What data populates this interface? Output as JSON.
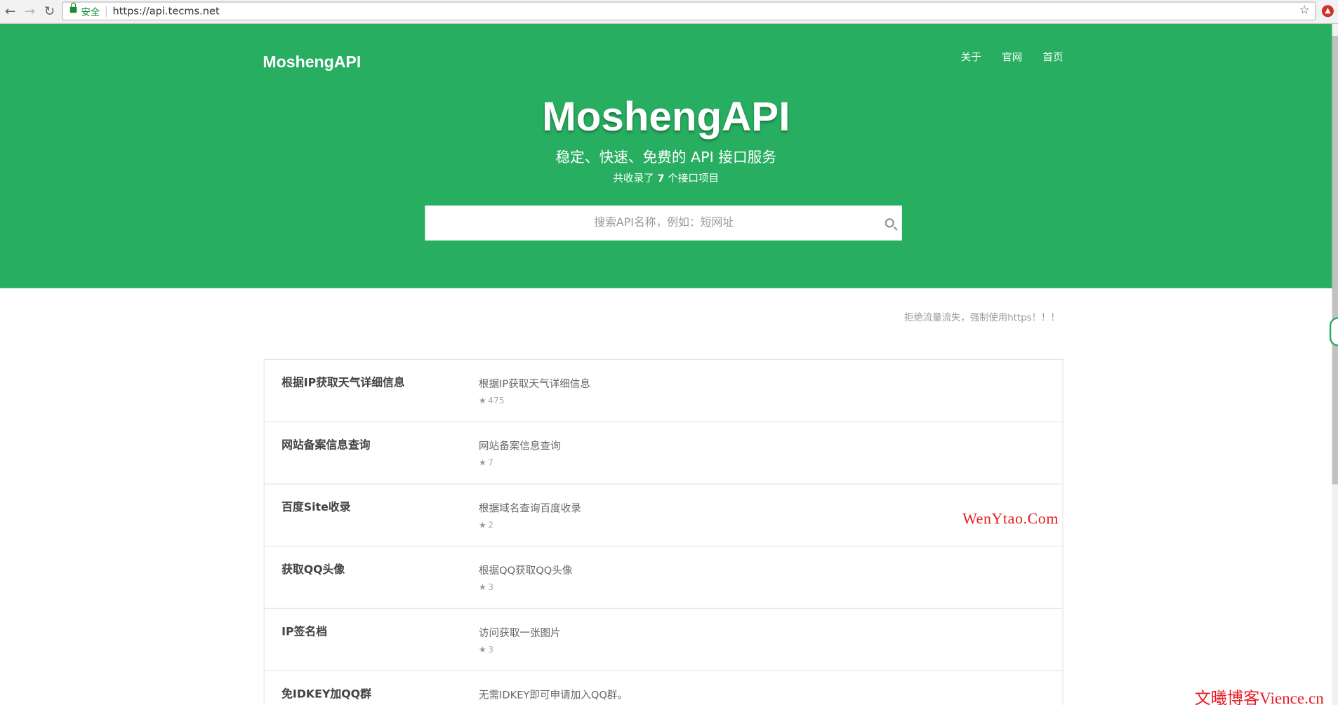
{
  "browser": {
    "secure_label": "安全",
    "url": "https://api.tecms.net"
  },
  "site": {
    "brand": "MoshengAPI",
    "nav": [
      "关于",
      "官网",
      "首页"
    ],
    "title": "MoshengAPI",
    "subtitle": "稳定、快速、免费的 API 接口服务",
    "count_prefix": "共收录了",
    "count": "7",
    "count_suffix": "个接口项目",
    "search_placeholder": "搜索API名称，例如：短网址",
    "notice": "拒绝流量流失，强制使用https！！！"
  },
  "apis": [
    {
      "name": "根据IP获取天气详细信息",
      "desc": "根据IP获取天气详细信息",
      "stars": "475"
    },
    {
      "name": "网站备案信息查询",
      "desc": "网站备案信息查询",
      "stars": "7"
    },
    {
      "name": "百度Site收录",
      "desc": "根据域名查询百度收录",
      "stars": "2"
    },
    {
      "name": "获取QQ头像",
      "desc": "根据QQ获取QQ头像",
      "stars": "3"
    },
    {
      "name": "IP签名档",
      "desc": "访问获取一张图片",
      "stars": "3"
    },
    {
      "name": "免IDKEY加QQ群",
      "desc": "无需IDKEY即可申请加入QQ群。",
      "stars": ""
    }
  ],
  "watermarks": {
    "primary": "WenYtao.Com",
    "secondary": "文曦博客Vience.cn"
  },
  "colors": {
    "hero_green": "#27ae60",
    "watermark_red": "#e81b23"
  }
}
